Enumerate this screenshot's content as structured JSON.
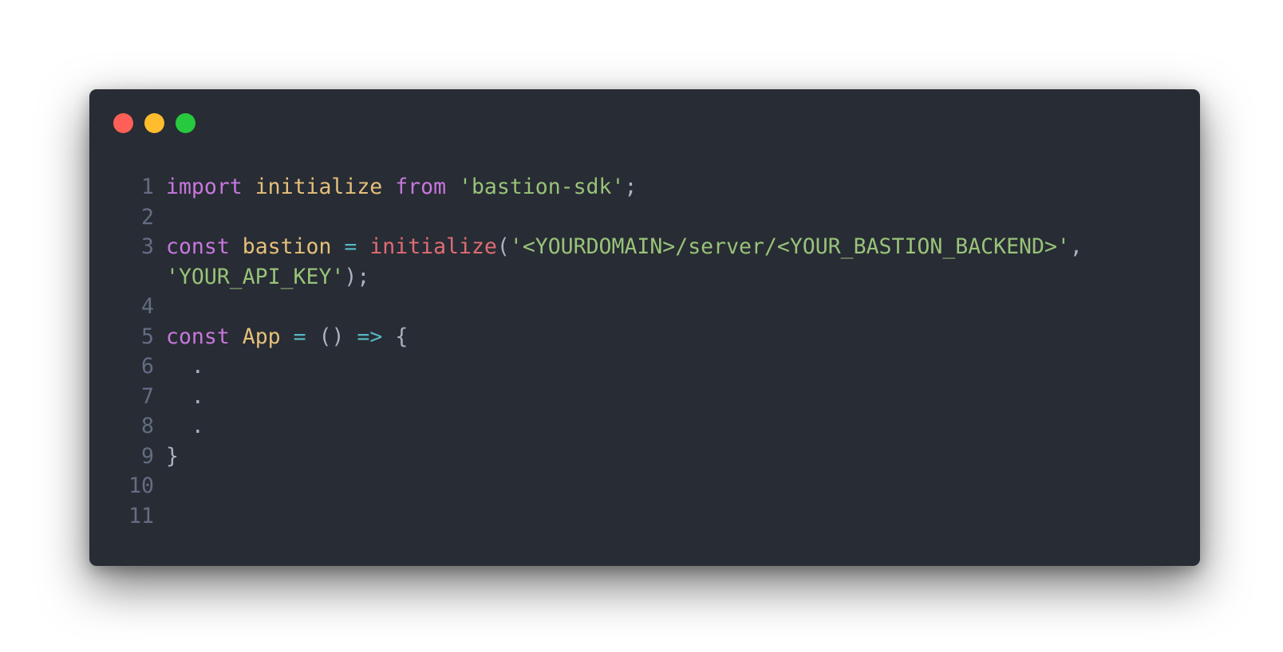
{
  "window": {
    "buttons": [
      {
        "name": "close",
        "color": "#ff5f56"
      },
      {
        "name": "minimize",
        "color": "#ffbd2e"
      },
      {
        "name": "zoom",
        "color": "#27c93f"
      }
    ]
  },
  "code": {
    "lines": [
      {
        "num": "1",
        "tokens": [
          {
            "t": "import",
            "c": "kw"
          },
          {
            "t": " ",
            "c": "punc"
          },
          {
            "t": "initialize",
            "c": "fn"
          },
          {
            "t": " ",
            "c": "punc"
          },
          {
            "t": "from",
            "c": "kw"
          },
          {
            "t": " ",
            "c": "punc"
          },
          {
            "t": "'bastion-sdk'",
            "c": "str"
          },
          {
            "t": ";",
            "c": "punc"
          }
        ]
      },
      {
        "num": "2",
        "tokens": []
      },
      {
        "num": "3",
        "tokens": [
          {
            "t": "const",
            "c": "kw"
          },
          {
            "t": " ",
            "c": "punc"
          },
          {
            "t": "bastion",
            "c": "fn"
          },
          {
            "t": " ",
            "c": "punc"
          },
          {
            "t": "=",
            "c": "op"
          },
          {
            "t": " ",
            "c": "punc"
          },
          {
            "t": "initialize",
            "c": "call"
          },
          {
            "t": "(",
            "c": "punc"
          },
          {
            "t": "'<YOURDOMAIN>/server/<YOUR_BASTION_BACKEND>'",
            "c": "str"
          },
          {
            "t": ",",
            "c": "punc"
          }
        ],
        "continuation": [
          {
            "t": "'YOUR_API_KEY'",
            "c": "str"
          },
          {
            "t": ");",
            "c": "punc"
          }
        ]
      },
      {
        "num": "4",
        "tokens": []
      },
      {
        "num": "5",
        "tokens": [
          {
            "t": "const",
            "c": "kw"
          },
          {
            "t": " ",
            "c": "punc"
          },
          {
            "t": "App",
            "c": "fn"
          },
          {
            "t": " ",
            "c": "punc"
          },
          {
            "t": "=",
            "c": "op"
          },
          {
            "t": " ",
            "c": "punc"
          },
          {
            "t": "()",
            "c": "punc"
          },
          {
            "t": " ",
            "c": "punc"
          },
          {
            "t": "=>",
            "c": "op"
          },
          {
            "t": " ",
            "c": "punc"
          },
          {
            "t": "{",
            "c": "punc"
          }
        ]
      },
      {
        "num": "6",
        "tokens": [
          {
            "t": "  .",
            "c": "punc"
          }
        ]
      },
      {
        "num": "7",
        "tokens": [
          {
            "t": "  .",
            "c": "punc"
          }
        ]
      },
      {
        "num": "8",
        "tokens": [
          {
            "t": "  .",
            "c": "punc"
          }
        ]
      },
      {
        "num": "9",
        "tokens": [
          {
            "t": "}",
            "c": "punc"
          }
        ]
      },
      {
        "num": "10",
        "tokens": []
      },
      {
        "num": "11",
        "tokens": []
      }
    ]
  }
}
